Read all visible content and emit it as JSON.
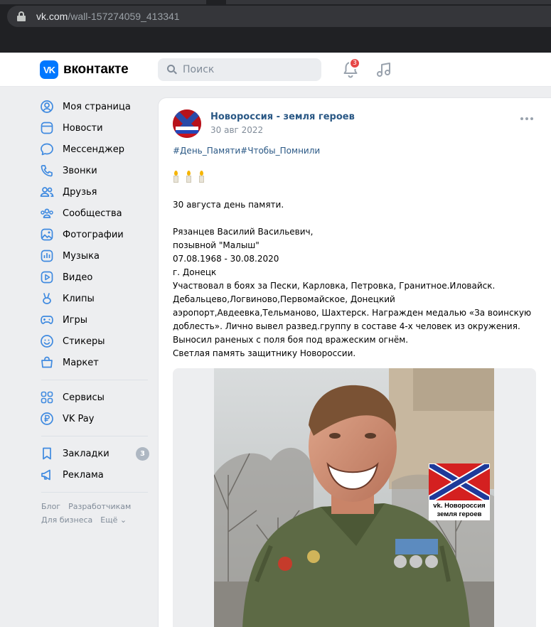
{
  "browser": {
    "url_host": "vk.com",
    "url_path": "/wall-157274059_413341"
  },
  "header": {
    "logo_mark": "VK",
    "logo_text": "вконтакте",
    "search_placeholder": "Поиск",
    "notifications_count": "3"
  },
  "sidebar": {
    "items": [
      {
        "label": "Моя страница",
        "icon": "profile-icon"
      },
      {
        "label": "Новости",
        "icon": "news-icon"
      },
      {
        "label": "Мессенджер",
        "icon": "messenger-icon"
      },
      {
        "label": "Звонки",
        "icon": "phone-icon"
      },
      {
        "label": "Друзья",
        "icon": "friends-icon"
      },
      {
        "label": "Сообщества",
        "icon": "communities-icon"
      },
      {
        "label": "Фотографии",
        "icon": "photos-icon"
      },
      {
        "label": "Музыка",
        "icon": "music-icon"
      },
      {
        "label": "Видео",
        "icon": "video-icon"
      },
      {
        "label": "Клипы",
        "icon": "clips-icon"
      },
      {
        "label": "Игры",
        "icon": "games-icon"
      },
      {
        "label": "Стикеры",
        "icon": "stickers-icon"
      },
      {
        "label": "Маркет",
        "icon": "market-icon"
      }
    ],
    "services": [
      {
        "label": "Сервисы",
        "icon": "services-icon"
      },
      {
        "label": "VK Pay",
        "icon": "vkpay-icon"
      }
    ],
    "extras": [
      {
        "label": "Закладки",
        "icon": "bookmarks-icon",
        "badge": "3"
      },
      {
        "label": "Реклама",
        "icon": "ads-icon"
      }
    ],
    "footer": [
      "Блог",
      "Разработчикам",
      "Для бизнеса",
      "Ещё ⌄"
    ]
  },
  "post": {
    "author": "Новороссия - земля героев",
    "date": "30 авг 2022",
    "hashtags": "#День_Памяти#Чтобы_Помнили",
    "lines": {
      "l1": "30 августа день памяти.",
      "l2": "Рязанцев Василий Васильевич,",
      "l3": "позывной \"Малыш\"",
      "l4": "07.08.1968 - 30.08.2020",
      "l5": "г. Донецк",
      "l6": "Участвовал в боях за Пески, Карловка, Петровка, Гранитное.Иловайск. Дебальцево,Логвиново,Первомайское, Донецкий аэропорт,Авдеевка,Тельманово, Шахтерск. Награжден медалью «За воинскую доблесть». Лично вывел развед.группу в составе 4-х человек из окружения. Выносил раненых с поля боя под вражеским огнём.",
      "l7": "Светлая память защитнику Новороссии."
    },
    "photo_watermark_line1": "vk. Новороссия",
    "photo_watermark_line2": "земля героев"
  },
  "colors": {
    "accent": "#0077ff",
    "link": "#2a5885",
    "badge_red": "#e64646",
    "page_bg": "#edeef0"
  }
}
